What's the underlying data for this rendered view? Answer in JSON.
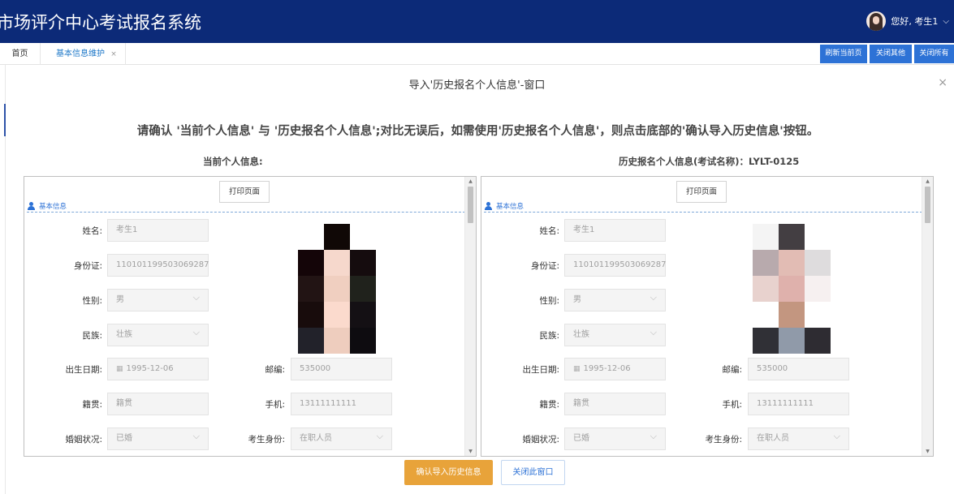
{
  "app": {
    "title": "市场评介中心考试报名系统"
  },
  "user": {
    "greeting": "您好, 考生1"
  },
  "tabs": [
    {
      "label": "首页"
    },
    {
      "label": "基本信息维护",
      "close": "×"
    }
  ],
  "toolbar": {
    "refresh": "刷新当前页",
    "close_others": "关闭其他",
    "close_all": "关闭所有"
  },
  "window": {
    "title": "导入'历史报名个人信息'-窗口",
    "close": "×",
    "instruction": "请确认 '当前个人信息' 与 '历史报名个人信息';对比无误后，如需使用'历史报名个人信息'，则点击底部的'确认导入历史信息'按钮。"
  },
  "current": {
    "heading": "当前个人信息:",
    "print_label": "打印页面",
    "section": "基本信息",
    "labels": {
      "name": "姓名:",
      "id": "身份证:",
      "gender": "性别:",
      "ethnicity": "民族:",
      "birth": "出生日期:",
      "zip": "邮编:",
      "native": "籍贯:",
      "phone": "手机:",
      "marital": "婚姻状况:",
      "identity": "考生身份:"
    },
    "values": {
      "name": "考生1",
      "id": "110101199503069287",
      "gender": "男",
      "ethnicity": "壮族",
      "birth": "1995-12-06",
      "zip": "535000",
      "native": "籍贯",
      "phone": "13111111111",
      "marital": "已婚",
      "identity": "在职人员"
    }
  },
  "history": {
    "heading": "历史报名个人信息(考试名称)：LYLT-0125",
    "print_label": "打印页面",
    "section": "基本信息",
    "labels": {
      "name": "姓名:",
      "id": "身份证:",
      "gender": "性别:",
      "ethnicity": "民族:",
      "birth": "出生日期:",
      "zip": "邮编:",
      "native": "籍贯:",
      "phone": "手机:",
      "marital": "婚姻状况:",
      "identity": "考生身份:"
    },
    "values": {
      "name": "考生1",
      "id": "110101199503069287",
      "gender": "男",
      "ethnicity": "壮族",
      "birth": "1995-12-06",
      "zip": "535000",
      "native": "籍贯",
      "phone": "13111111111",
      "marital": "已婚",
      "identity": "在职人员"
    }
  },
  "footer": {
    "confirm": "确认导入历史信息",
    "close": "关闭此窗口"
  },
  "colors": {
    "topbar": "#0c2a78",
    "accent": "#2d72d6",
    "confirm": "#e8a33a"
  },
  "icons": [
    "user-avatar-icon",
    "chevron-down-icon",
    "close-icon",
    "user-section-icon",
    "calendar-icon",
    "select-chevron-icon",
    "scroll-up-icon",
    "scroll-down-icon"
  ]
}
